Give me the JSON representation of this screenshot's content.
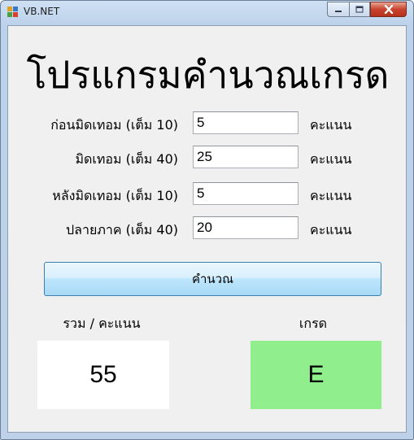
{
  "window": {
    "title": "VB.NET",
    "controls": {
      "minimize": "minimize",
      "maximize": "maximize",
      "close": "close"
    }
  },
  "heading": "โปรแกรมคำนวณเกรด",
  "fields": [
    {
      "label": "ก่อนมิดเทอม (เต็ม 10)",
      "value": "5",
      "unit": "คะแนน"
    },
    {
      "label": "มิดเทอม (เต็ม 40)",
      "value": "25",
      "unit": "คะแนน"
    },
    {
      "label": "หลังมิดเทอม (เต็ม 10)",
      "value": "5",
      "unit": "คะแนน"
    },
    {
      "label": "ปลายภาค (เต็ม 40)",
      "value": "20",
      "unit": "คะแนน"
    }
  ],
  "calculate_button": "คำนวณ",
  "result": {
    "total_label": "รวม / คะแนน",
    "total_value": "55",
    "grade_label": "เกรด",
    "grade_value": "E",
    "grade_color": "#90ee8c"
  },
  "colors": {
    "title_bar": "#c3d6ee",
    "client_bg": "#f0f0f0",
    "button_border": "#3c7fb1",
    "close_button": "#c8432e"
  }
}
